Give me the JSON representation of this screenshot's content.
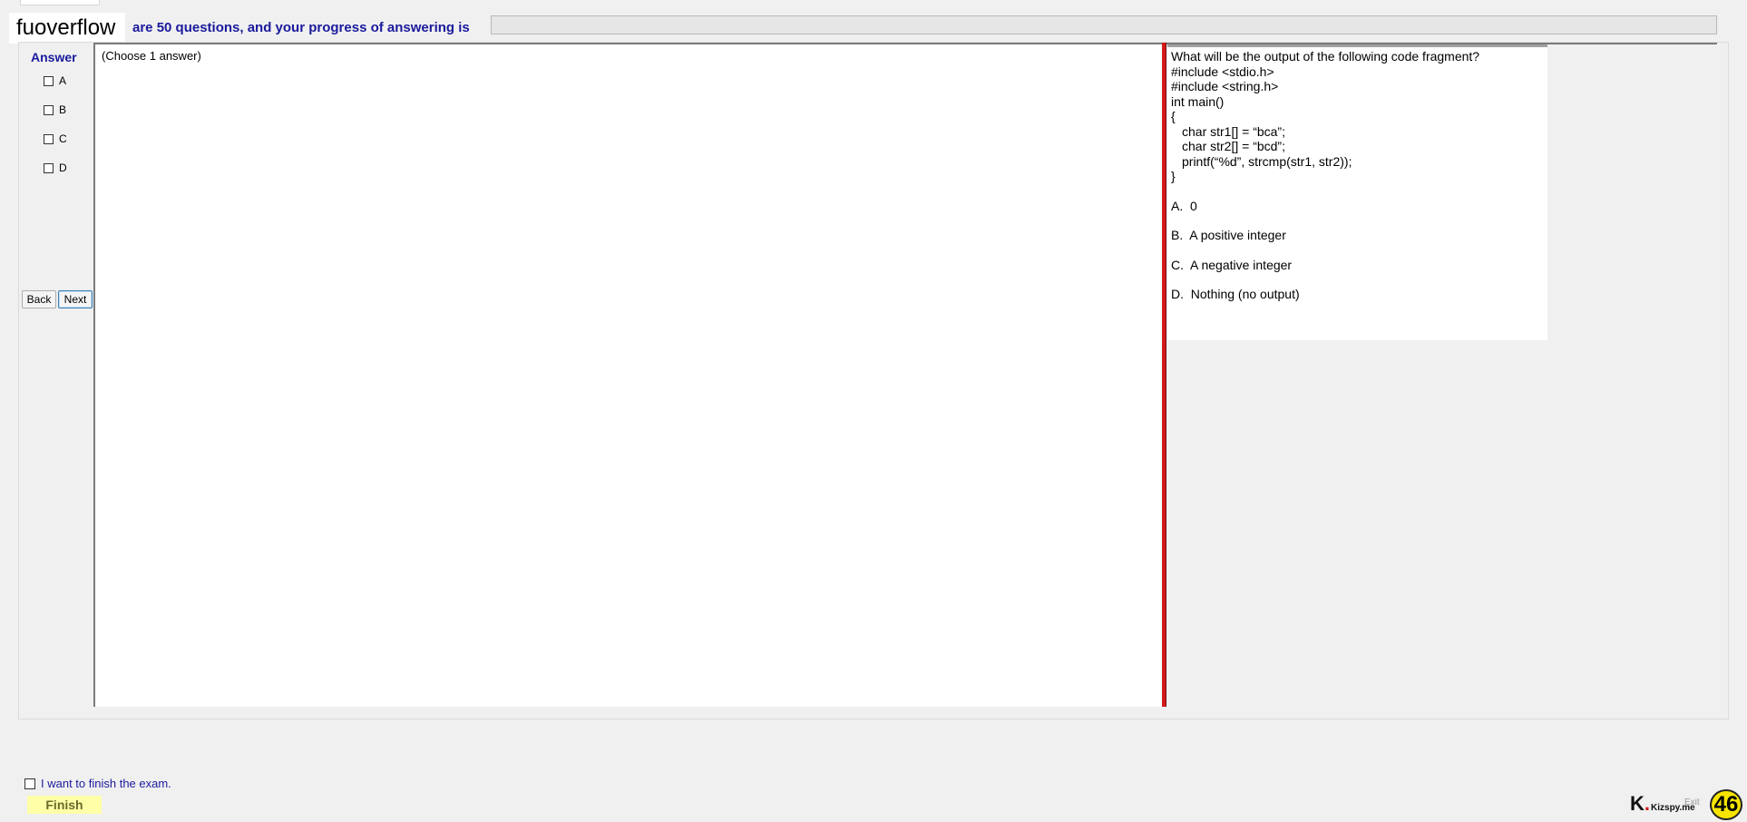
{
  "header": {
    "logo": "fuoverflow",
    "progress_text": "are 50 questions, and your progress of answering is",
    "progress_fraction": 0.0
  },
  "answer_panel": {
    "title": "Answer",
    "options": [
      "A",
      "B",
      "C",
      "D"
    ],
    "back_label": "Back",
    "next_label": "Next"
  },
  "middle": {
    "instruction": "(Choose 1 answer)"
  },
  "question": {
    "lines": [
      "What will be the output of the following code fragment?",
      "#include <stdio.h>",
      "#include <string.h>",
      "int main()",
      "{",
      "char str1[] = “bca”;",
      "char str2[] = “bcd”;",
      "printf(“%d”, strcmp(str1, str2));",
      "}"
    ],
    "options": [
      "A.  0",
      "B.  A positive integer",
      "C.  A negative integer",
      "D.  Nothing (no output)"
    ]
  },
  "footer": {
    "finish_checkbox_label": "I want to finish the exam.",
    "finish_button": "Finish",
    "exit_label": "Exit",
    "brand_text": "Kizspy.me",
    "counter": "46"
  },
  "colors": {
    "accent_blue": "#1a1a9c",
    "divider_red": "#d21a1a",
    "finish_yellow": "#ffffa8",
    "badge_yellow": "#f5e400"
  }
}
